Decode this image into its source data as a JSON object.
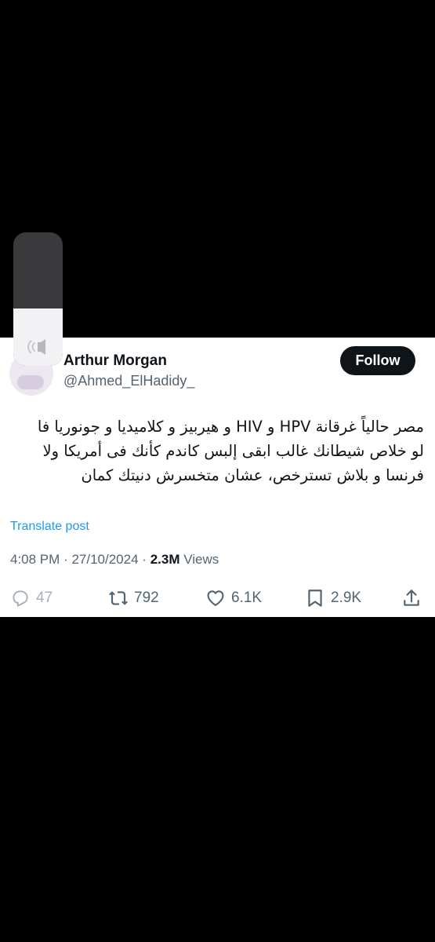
{
  "tweet": {
    "author_name": "Arthur Morgan",
    "handle": "@Ahmed_ElHadidy_",
    "follow_label": "Follow",
    "text_lines": [
      "مصر حالياً غرقانة HPV و HIV و هيربيز و كلاميديا و جونوريا فا",
      "لو خلاص شيطانك غالب ابقى إلبس كاندم كأنك فى أمريكا ولا",
      "فرنسا و بلاش تسترخص، عشان متخسرش دنيتك كمان"
    ],
    "translate_label": "Translate post",
    "time": "4:08 PM",
    "date": "27/10/2024",
    "separator_1": "·",
    "separator_2": "·",
    "views_count": "2.3M",
    "views_label": "Views"
  },
  "actions": {
    "reply_count": "47",
    "repost_count": "792",
    "like_count": "6.1K",
    "bookmark_count": "2.9K"
  },
  "volume_hud": {
    "level": 0.43,
    "icon": "speaker-icon"
  },
  "colors": {
    "background": "#000000",
    "card": "#ffffff",
    "text": "#0f1419",
    "secondary": "#536471",
    "link": "#1d9bf0"
  }
}
